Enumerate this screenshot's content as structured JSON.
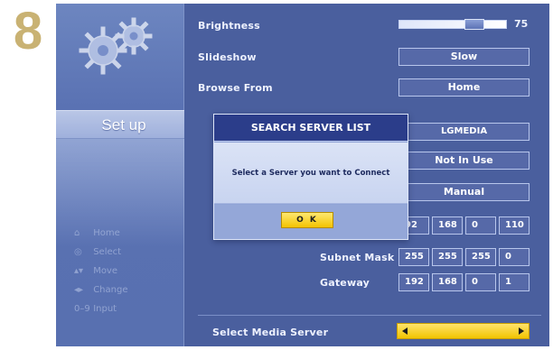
{
  "step_number": "8",
  "left_panel": {
    "setup_tab_label": "Set up",
    "legend": [
      {
        "icon": "home-icon",
        "glyph": "⌂",
        "label": "Home"
      },
      {
        "icon": "select-icon",
        "glyph": "◎",
        "label": "Select"
      },
      {
        "icon": "move-icon",
        "glyph": "▴▾",
        "label": "Move"
      },
      {
        "icon": "change-icon",
        "glyph": "◂▸",
        "label": "Change"
      },
      {
        "icon": "input-icon",
        "glyph": "0–9",
        "label": "Input"
      }
    ]
  },
  "settings": {
    "brightness": {
      "label": "Brightness",
      "value": "75",
      "level": 0.75
    },
    "slideshow": {
      "label": "Slideshow",
      "value": "Slow"
    },
    "browse_from": {
      "label": "Browse From",
      "value": "Home"
    },
    "server_name": {
      "value": "LGMEDIA"
    },
    "row5": {
      "value": "Not In Use"
    },
    "row6": {
      "value": "Manual"
    },
    "ip_address": {
      "octets": [
        "92",
        "168",
        "0",
        "110"
      ]
    },
    "subnet_mask": {
      "label": "Subnet Mask",
      "octets": [
        "255",
        "255",
        "255",
        "0"
      ]
    },
    "gateway": {
      "label": "Gateway",
      "octets": [
        "192",
        "168",
        "0",
        "1"
      ]
    },
    "select_media_server": {
      "label": "Select Media Server"
    }
  },
  "modal": {
    "title": "SEARCH SERVER LIST",
    "message": "Select a Server you want to Connect",
    "ok_label": "O K"
  },
  "colors": {
    "accent": "#f2c400",
    "screen_bg": "#4a5f9e",
    "modal_header": "#2b3d8a",
    "step_number": "#c9b273"
  }
}
